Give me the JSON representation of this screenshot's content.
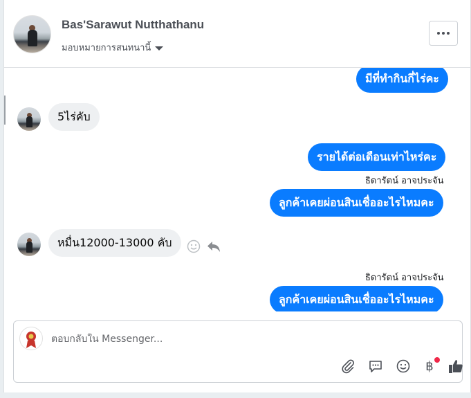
{
  "header": {
    "name": "Bas'Sarawut Nutthathanu",
    "subtitle": "มอบหมายการสนทนานี้",
    "more_label": "…"
  },
  "messages": [
    {
      "dir": "out",
      "text": "มีที่ทำกินกี่ไร่คะ"
    },
    {
      "dir": "in",
      "text": "5ไร่คับ"
    },
    {
      "dir": "out",
      "text": "รายได้ต่อเดือนเท่าไหร่คะ"
    },
    {
      "dir": "out",
      "sender": "ธิดารัตน์ อาจประจัน",
      "text": "ลูกค้าเคยผ่อนสินเชื่ออะไรไหมคะ"
    },
    {
      "dir": "in",
      "text": "หมื่น12000-13000 คับ"
    },
    {
      "dir": "out",
      "sender": "ธิดารัตน์ อาจประจัน",
      "text": "ลูกค้าเคยผ่อนสินเชื่ออะไรไหมคะ"
    }
  ],
  "composer": {
    "placeholder": "ตอบกลับใน Messenger...",
    "currency_symbol": "฿"
  },
  "colors": {
    "outgoing": "#0a7cff",
    "incoming": "#eef0f2",
    "notification": "#f02849"
  },
  "icons": [
    "chevron-down-icon",
    "more-icon",
    "smiley-icon",
    "reply-icon",
    "attachment-icon",
    "chat-icon",
    "emoji-icon",
    "baht-icon",
    "thumbs-up-icon"
  ]
}
